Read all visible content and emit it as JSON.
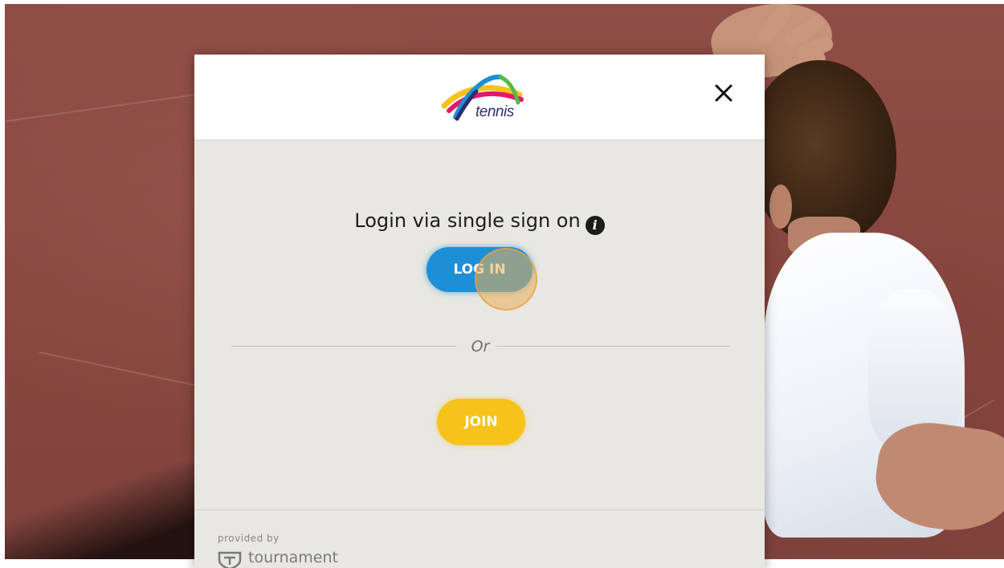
{
  "background": {
    "court_color": "#8b4b44"
  },
  "modal": {
    "logo": {
      "text": "tennis",
      "colors": [
        "#f7c21a",
        "#e5176b",
        "#1d8fd6",
        "#58b947",
        "#2d2e72"
      ]
    },
    "close_icon": "close-icon",
    "sso_title": "Login via single sign on",
    "info_icon": "i",
    "login_label": "LOG IN",
    "divider_text": "Or",
    "join_label": "JOIN",
    "footer": {
      "provided_by": "provided by",
      "brand": "tournament"
    }
  },
  "colors": {
    "login_button": "#1d8fd6",
    "join_button": "#f7c21a",
    "panel_background": "#e8e7e2"
  }
}
